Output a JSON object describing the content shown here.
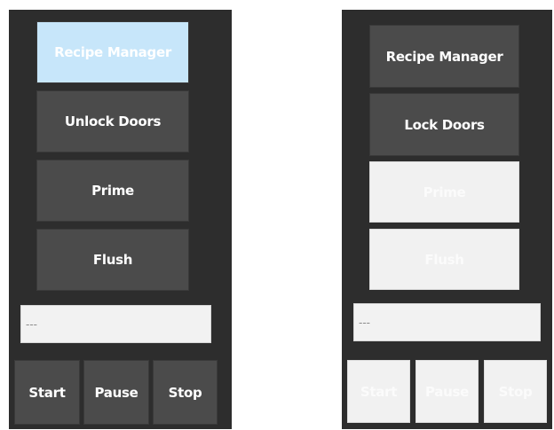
{
  "left_panel": {
    "recipe_manager": "Recipe Manager",
    "door_button": "Unlock Doors",
    "prime": "Prime",
    "flush": "Flush",
    "status_value": "---",
    "start": "Start",
    "pause": "Pause",
    "stop": "Stop"
  },
  "right_panel": {
    "recipe_manager": "Recipe Manager",
    "door_button": "Lock Doors",
    "prime": "Prime",
    "flush": "Flush",
    "status_value": "---",
    "start": "Start",
    "pause": "Pause",
    "stop": "Stop"
  },
  "colors": {
    "panel_bg": "#2d2d2d",
    "button_bg": "#4b4b4b",
    "active_button_bg": "#c7e6fa",
    "disabled_button_bg": "#f1f1f1"
  }
}
